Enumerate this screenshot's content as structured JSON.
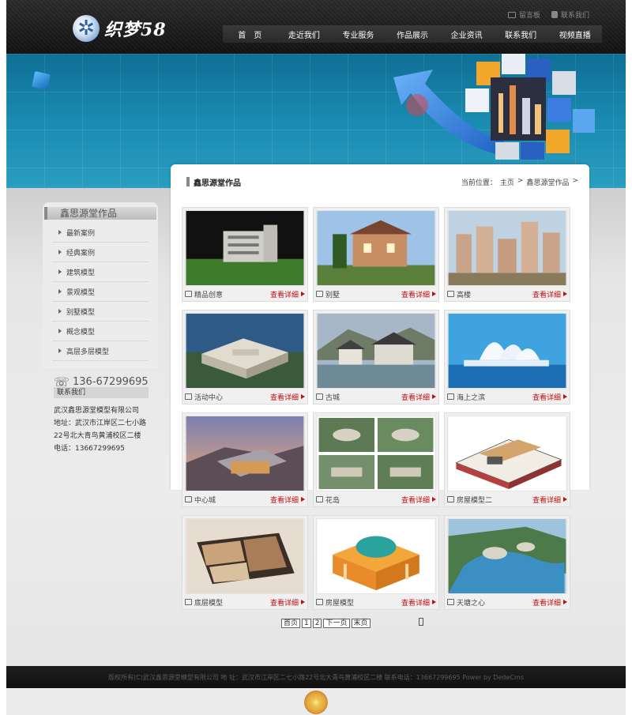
{
  "header": {
    "logo_text": "织梦58",
    "util_links": [
      "留言板",
      "联系我们"
    ],
    "nav": [
      "首　页",
      "走近我们",
      "专业服务",
      "作品展示",
      "企业资讯",
      "联系我们",
      "视频直播"
    ]
  },
  "sidebar": {
    "title": "鑫思源堂作品",
    "items": [
      "最新案例",
      "经典案例",
      "建筑模型",
      "景观模型",
      "别墅模型",
      "概念模型",
      "高层多层模型"
    ],
    "phone": "136-67299695",
    "contact_title": "联系我们",
    "contact_lines": [
      "武汉鑫思源堂模型有限公司",
      "地址：武汉市江岸区二七小路",
      "22号北大青鸟黄浦校区二楼",
      "电话：13667299695"
    ]
  },
  "main": {
    "title": "鑫思源堂作品",
    "breadcrumb": [
      "当前位置：",
      "主页",
      ">",
      "鑫思源堂作品",
      ">"
    ],
    "more_label": "查看详细",
    "items": [
      "精品创意",
      "别墅",
      "高楼",
      "活动中心",
      "古城",
      "海上之滨",
      "中心城",
      "花岛",
      "房屋模型二",
      "底层模型",
      "房屋模型",
      "天塘之心"
    ]
  },
  "pager": [
    "首页",
    "1",
    "2",
    "下一页",
    "末页"
  ],
  "footer": {
    "text": "版权所有(C)武汉鑫思源堂模型有限公司 地 址：武汉市江岸区二七小路22号北大青鸟黄浦校区二楼 联系电话：13667299695 Power by DedeCms"
  },
  "colors": {
    "accent_red": "#c30d0d",
    "banner_blue": "#1b8db3",
    "header_dark": "#1b1b1b"
  }
}
